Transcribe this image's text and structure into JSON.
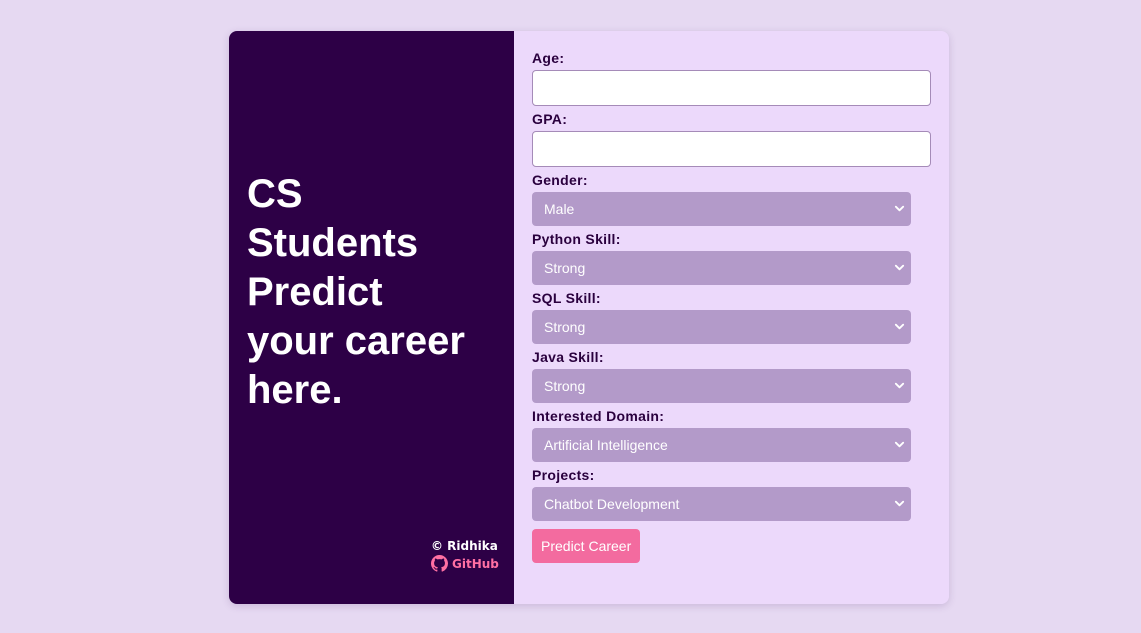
{
  "hero": {
    "title": "CS Students Predict your career here."
  },
  "footer": {
    "credit": "© Ridhika",
    "github_label": "GitHub"
  },
  "form": {
    "age_label": "Age:",
    "age_value": "",
    "gpa_label": "GPA:",
    "gpa_value": "",
    "gender_label": "Gender:",
    "gender_value": "Male",
    "python_label": "Python Skill:",
    "python_value": "Strong",
    "sql_label": "SQL Skill:",
    "sql_value": "Strong",
    "java_label": "Java Skill:",
    "java_value": "Strong",
    "domain_label": "Interested Domain:",
    "domain_value": "Artificial Intelligence",
    "projects_label": "Projects:",
    "projects_value": "Chatbot Development",
    "submit_label": "Predict Career"
  },
  "icons": {
    "github": "github-icon",
    "dropdown": "chevron-down-icon"
  },
  "colors": {
    "page_background": "#e6d9f2",
    "left_panel": "#2d0046",
    "right_panel": "#ecd9fb",
    "select_fill": "#b39ac9",
    "accent_pink": "#f36b9f",
    "label_text": "#2a003e"
  }
}
